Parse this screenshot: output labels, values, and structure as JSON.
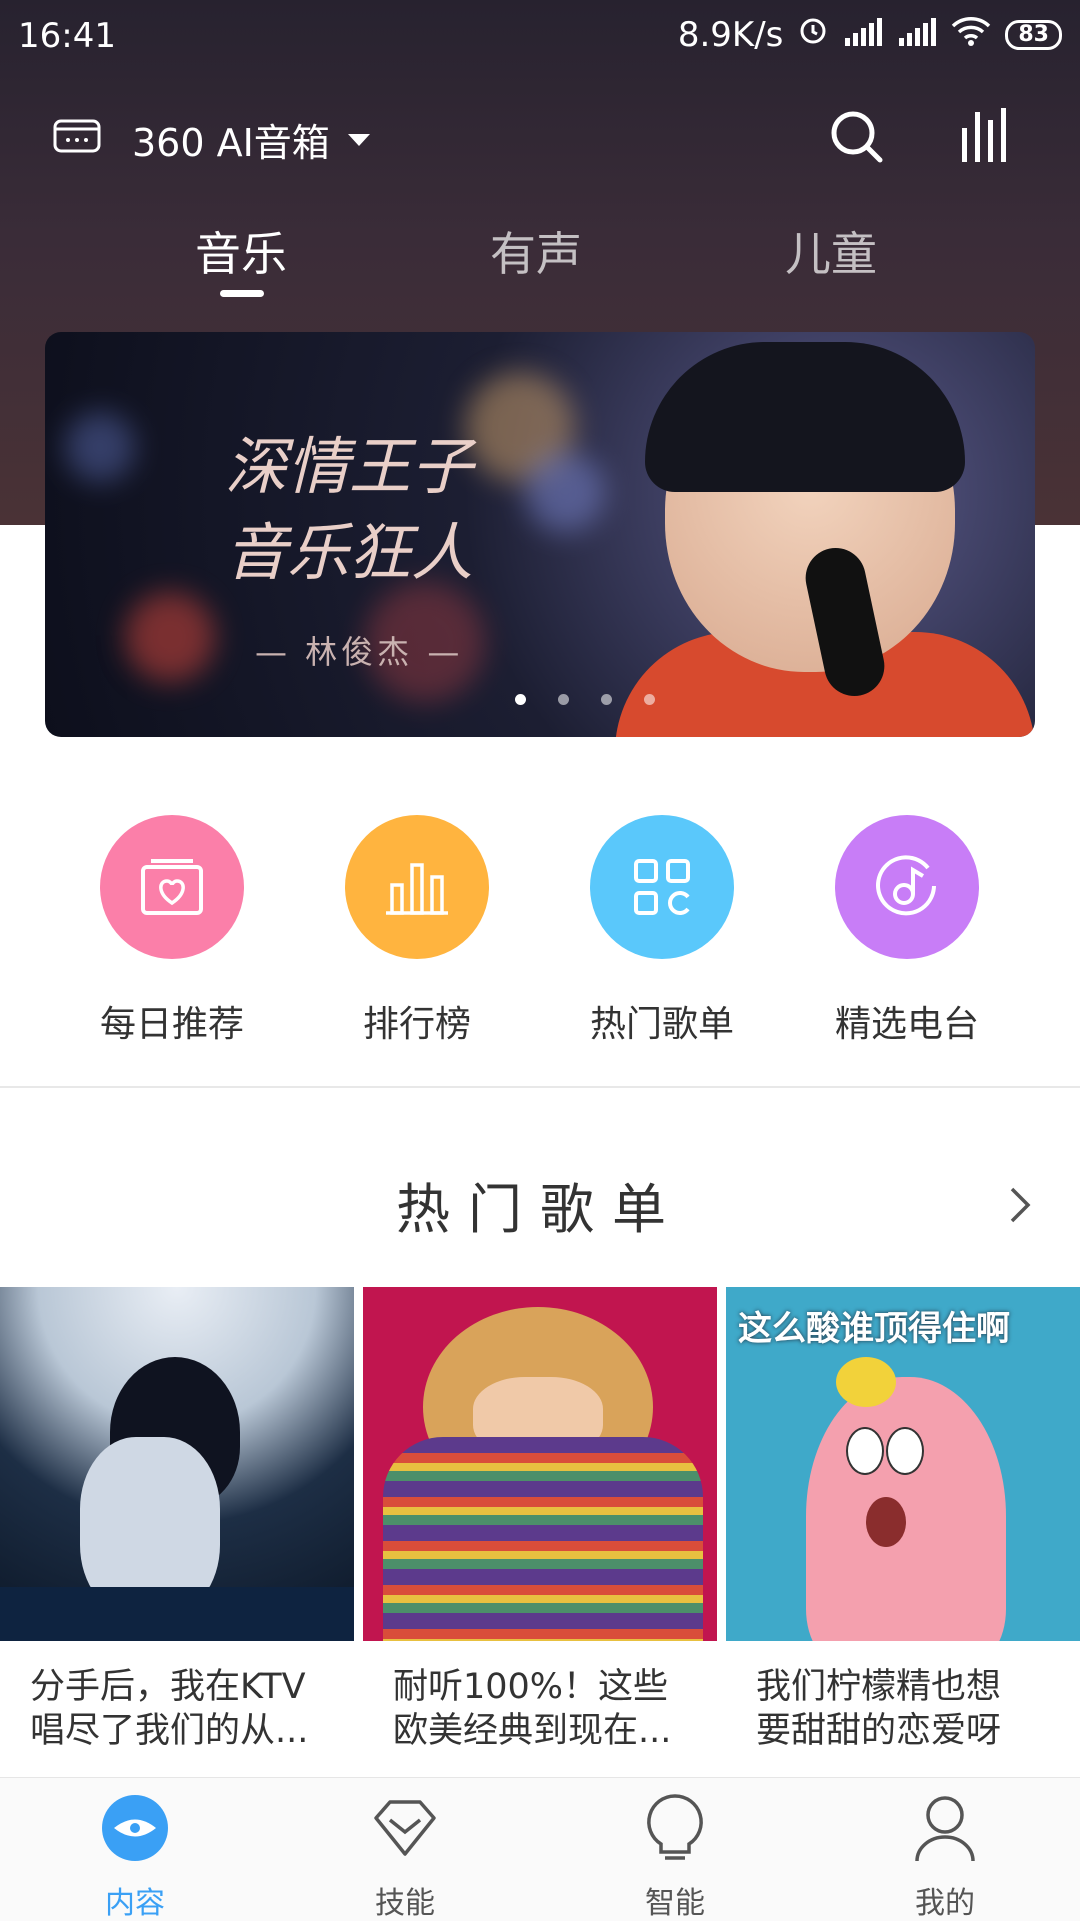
{
  "status": {
    "time": "16:41",
    "net_speed": "8.9K/s",
    "battery": "83"
  },
  "header": {
    "device_name": "360 AI音箱"
  },
  "tabs": [
    {
      "label": "音乐",
      "active": true
    },
    {
      "label": "有声",
      "active": false
    },
    {
      "label": "儿童",
      "active": false
    }
  ],
  "banner": {
    "line1": "深情王子",
    "line2": "音乐狂人",
    "subtitle": "— 林俊杰 —",
    "dots_total": 4,
    "dot_active": 1
  },
  "quick_actions": [
    {
      "label": "每日推荐",
      "color": "#fb7fa9",
      "icon": "calendar-heart-icon"
    },
    {
      "label": "排行榜",
      "color": "#ffb43f",
      "icon": "bar-chart-icon"
    },
    {
      "label": "热门歌单",
      "color": "#5ac8fb",
      "icon": "grid-icon"
    },
    {
      "label": "精选电台",
      "color": "#c87df7",
      "icon": "music-disc-icon"
    }
  ],
  "section": {
    "title": "热门歌单"
  },
  "playlists": [
    {
      "line1": "分手后，我在KTV",
      "line2": "唱尽了我们的从..."
    },
    {
      "line1": "耐听100%！这些",
      "line2": "欧美经典到现在..."
    },
    {
      "line1": "我们柠檬精也想",
      "line2": "要甜甜的恋爱呀",
      "overlay": "这么酸谁顶得住啊"
    }
  ],
  "nav": [
    {
      "label": "内容",
      "active": true,
      "icon": "eye-icon"
    },
    {
      "label": "技能",
      "active": false,
      "icon": "diamond-icon"
    },
    {
      "label": "智能",
      "active": false,
      "icon": "bulb-icon"
    },
    {
      "label": "我的",
      "active": false,
      "icon": "user-icon"
    }
  ],
  "colors": {
    "accent": "#3aa0f5"
  }
}
